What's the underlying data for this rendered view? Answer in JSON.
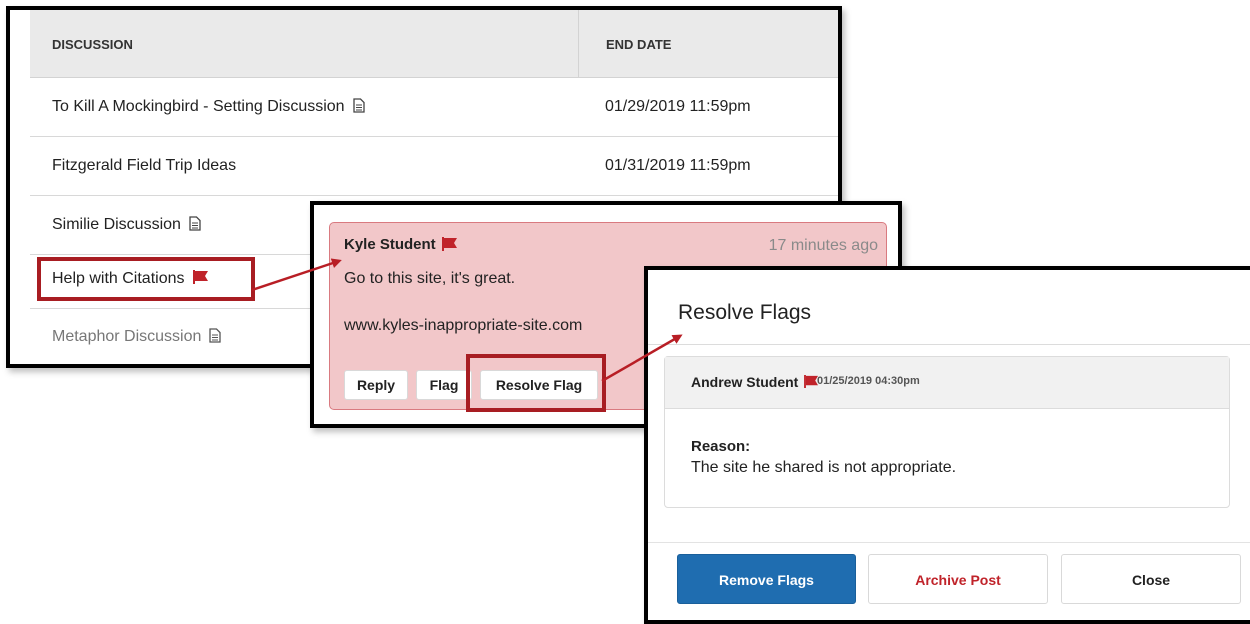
{
  "table": {
    "headers": {
      "discussion": "DISCUSSION",
      "end_date": "END DATE"
    },
    "rows": [
      {
        "title": "To Kill A Mockingbird - Setting Discussion",
        "icon": "document-icon",
        "end_date": "01/29/2019 11:59pm"
      },
      {
        "title": "Fitzgerald Field Trip Ideas",
        "icon": "",
        "end_date": "01/31/2019 11:59pm"
      },
      {
        "title": "Similie Discussion",
        "icon": "document-icon",
        "end_date": ""
      },
      {
        "title": "Help with Citations",
        "icon": "flag-icon",
        "end_date": ""
      },
      {
        "title": "Metaphor Discussion",
        "icon": "document-icon",
        "end_date": ""
      }
    ]
  },
  "post": {
    "author": "Kyle Student",
    "time": "17 minutes ago",
    "body_line1": "Go to this site, it's great.",
    "body_line2": "www.kyles-inappropriate-site.com",
    "buttons": {
      "reply": "Reply",
      "flag": "Flag",
      "resolve_flag": "Resolve Flag"
    }
  },
  "dialog": {
    "title": "Resolve Flags",
    "flag": {
      "author": "Andrew Student",
      "date": "01/25/2019 04:30pm",
      "reason_label": "Reason:",
      "reason_text": "The site he shared is not appropriate."
    },
    "buttons": {
      "remove_flags": "Remove Flags",
      "archive_post": "Archive Post",
      "close": "Close"
    }
  },
  "colors": {
    "flag": "#c0232a",
    "highlight": "#a81d22",
    "post_background": "#f2c7c9",
    "primary_button": "#1f6db0"
  }
}
